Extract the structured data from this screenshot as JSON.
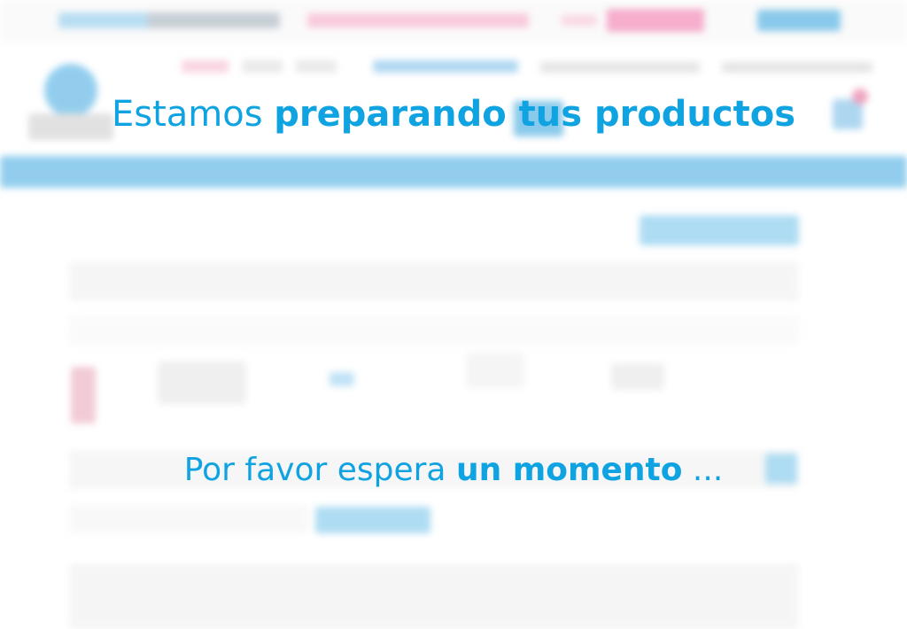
{
  "overlay": {
    "headline_regular": "Estamos ",
    "headline_bold": "preparando tus productos",
    "subline_regular": "Por favor espera ",
    "subline_bold": "un momento",
    "subline_suffix": " ..."
  },
  "colors": {
    "accent": "#0fa3e2",
    "brand_blue": "#3aa6e0",
    "promo_pink": "#f06da4"
  },
  "icons": [
    "cart-icon",
    "search-icon",
    "logo-icon"
  ]
}
